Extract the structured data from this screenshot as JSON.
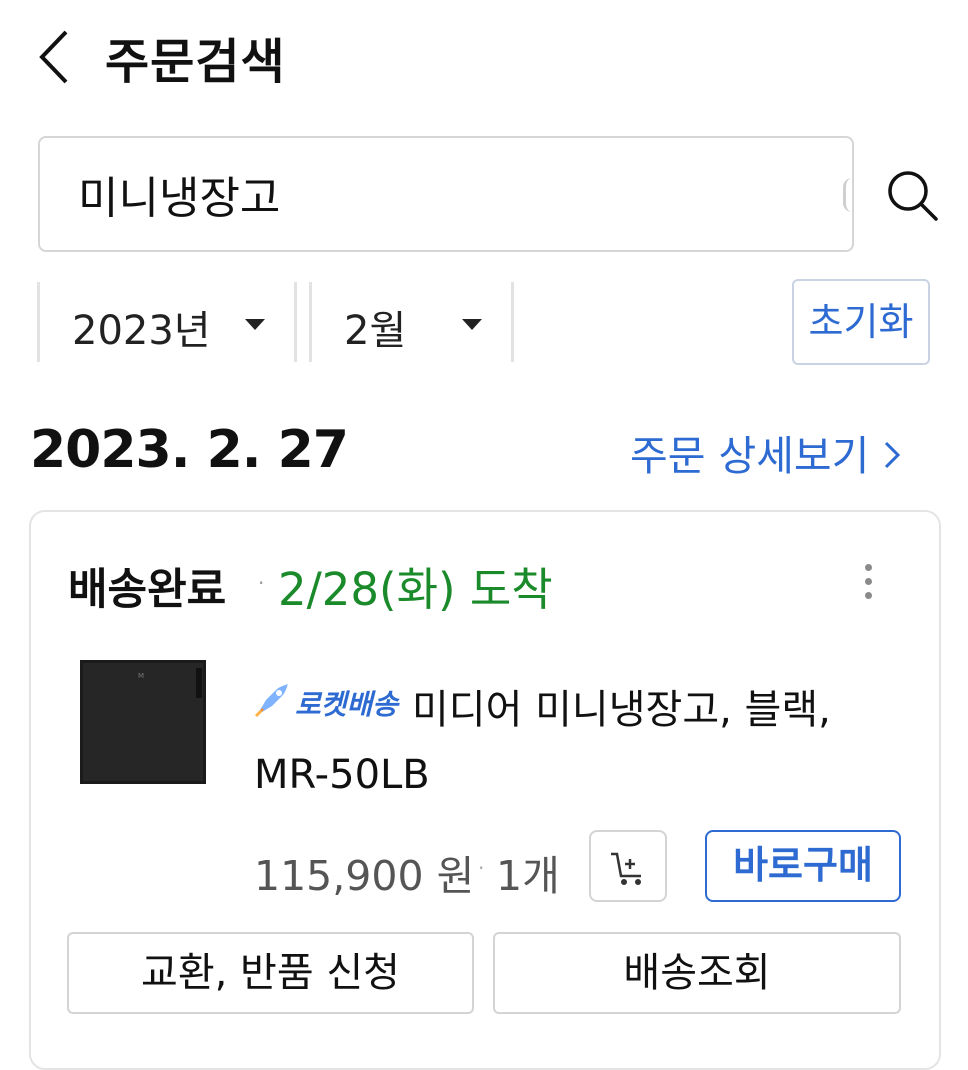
{
  "header": {
    "title": "주문검색",
    "back_icon": "chevron-left-icon"
  },
  "search": {
    "value": "미니냉장고",
    "icon": "search-icon"
  },
  "filters": {
    "year_label": "2023년",
    "month_label": "2월",
    "reset_label": "초기화"
  },
  "order": {
    "date": "2023. 2. 27",
    "detail_link": "주문 상세보기",
    "status": "배송완료",
    "arrival": "2/28(화) 도착",
    "item": {
      "badge": "로켓배송",
      "name_line1": "미디어 미니냉장고, 블랙,",
      "name_line2": "MR-50LB",
      "price": "115,900 원",
      "quantity": "1개",
      "buy_now_label": "바로구매"
    },
    "actions": {
      "return_label": "교환, 반품 신청",
      "track_label": "배송조회"
    }
  },
  "colors": {
    "accent_blue": "#2d6ad1",
    "arrival_green": "#1a8a2a",
    "border_gray": "#d4d4d4"
  }
}
